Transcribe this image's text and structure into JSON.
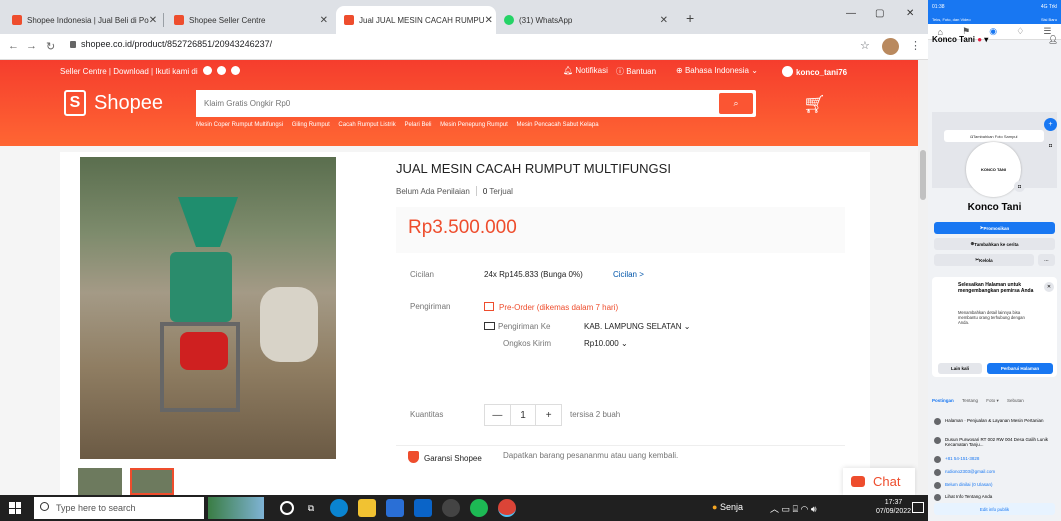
{
  "browser": {
    "tabs": [
      {
        "label": "Shopee Indonesia | Jual Beli di Po",
        "active": false
      },
      {
        "label": "Shopee Seller Centre",
        "active": false
      },
      {
        "label": "Jual JUAL MESIN CACAH RUMPU",
        "active": true
      },
      {
        "label": "(31) WhatsApp",
        "active": false
      }
    ],
    "new_tab": "+",
    "url": "shopee.co.id/product/852726851/20943246237/",
    "win_min": "—",
    "win_max": "▢",
    "win_close": "✕"
  },
  "shopee": {
    "seller_centre": "Seller Centre",
    "download": "Download",
    "follow": "Ikuti kami di",
    "notifications": "Notifikasi",
    "help": "Bantuan",
    "language": "Bahasa Indonesia",
    "username": "konco_tani76",
    "logo_text": "Shopee",
    "search_placeholder": "Klaim Gratis Ongkir Rp0",
    "suggestions": [
      "Mesin Coper Rumput Multifungsi",
      "Giling Rumput",
      "Cacah Rumput Listrik",
      "Pelari Beli",
      "Mesin Penepung Rumput",
      "Mesin Pencacah Sabut Kelapa"
    ]
  },
  "product": {
    "title": "JUAL MESIN CACAH RUMPUT MULTIFUNGSI",
    "rating_text": "Belum Ada Penilaian",
    "sold_count": "0",
    "sold_label": "Terjual",
    "price": "Rp3.500.000",
    "installment_label": "Cicilan",
    "installment_value": "24x Rp145.833 (Bunga 0%)",
    "installment_link": "Cicilan >",
    "shipping_label": "Pengiriman",
    "preorder": "Pre-Order (dikemas dalam 7 hari)",
    "ship_to_label": "Pengiriman Ke",
    "ship_to_value": "KAB. LAMPUNG SELATAN",
    "ship_cost_label": "Ongkos Kirim",
    "ship_cost_value": "Rp10.000",
    "qty_label": "Kuantitas",
    "qty_minus": "—",
    "qty_value": "1",
    "qty_plus": "+",
    "stock": "tersisa 2 buah",
    "guarantee_label": "Garansi Shopee",
    "guarantee_text": "Dapatkan barang pesananmu atau uang kembali.",
    "chat_label": "Chat"
  },
  "phone": {
    "status_time": "01:38",
    "status_right": "4G Trkl",
    "notif_left": "Teks, Foto, dan Video",
    "notif_right": "Sisi Baru",
    "page_name": "Konco Tani",
    "add_cover": "Tambahkan Foto Sampul",
    "pfp_text": "KONCO TANI",
    "title": "Konco Tani",
    "promote": "Promosikan",
    "add_story": "Tambahkan ke cerita",
    "manage": "Kelola",
    "more": "···",
    "promo_title": "Selesaikan Halaman untuk mengembangkan pemirsa Anda",
    "promo_desc": "Menambahkan detail lainnya bisa membantu orang terhubung dengan Anda.",
    "later": "Lain kali",
    "update": "Perbarui Halaman",
    "tabs": [
      "Postingan",
      "Tentang",
      "Foto ▾",
      "Sebutan"
    ],
    "info": [
      {
        "text": "Halaman · Penjualan & Layanan Mesin Pertanian",
        "link": false
      },
      {
        "text": "Dusun Purwosari RT 002 RW 004 Desa Galih Lunik Kecamatan Tanju...",
        "link": false
      },
      {
        "text": "+81 54-151-3828",
        "link": true
      },
      {
        "text": "rudiono2303@gmail.com",
        "link": true
      },
      {
        "text": "Belum dinilai (0 Ulasan)",
        "link": true
      },
      {
        "text": "Lihat Info Tentang Anda",
        "link": false
      }
    ],
    "edit_info": "Edit info publik"
  },
  "taskbar": {
    "search_placeholder": "Type here to search",
    "weather": "Senja",
    "time": "17:37",
    "date": "07/09/2022"
  },
  "colors": {
    "shopee_orange": "#ee4d2d",
    "fb_blue": "#1877f2",
    "taskbar": "#202020"
  }
}
